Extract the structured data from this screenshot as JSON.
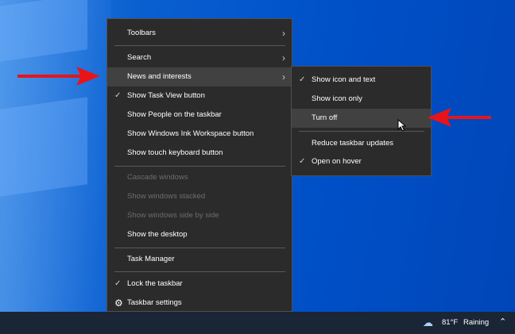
{
  "main_menu": {
    "items": [
      {
        "label": "Toolbars",
        "submenu": true
      },
      {
        "label": "Search",
        "submenu": true
      },
      {
        "label": "News and interests",
        "submenu": true,
        "highlighted": true
      },
      {
        "label": "Show Task View button",
        "checked": true
      },
      {
        "label": "Show People on the taskbar"
      },
      {
        "label": "Show Windows Ink Workspace button"
      },
      {
        "label": "Show touch keyboard button"
      },
      {
        "label": "Cascade windows",
        "disabled": true
      },
      {
        "label": "Show windows stacked",
        "disabled": true
      },
      {
        "label": "Show windows side by side",
        "disabled": true
      },
      {
        "label": "Show the desktop"
      },
      {
        "label": "Task Manager"
      },
      {
        "label": "Lock the taskbar",
        "checked": true
      },
      {
        "label": "Taskbar settings",
        "icon": "gear-icon"
      }
    ]
  },
  "submenu": {
    "items": [
      {
        "label": "Show icon and text",
        "checked": true
      },
      {
        "label": "Show icon only"
      },
      {
        "label": "Turn off",
        "highlighted": true
      },
      {
        "label": "Reduce taskbar updates"
      },
      {
        "label": "Open on hover",
        "checked": true
      }
    ]
  },
  "taskbar": {
    "weather_temp": "81°F",
    "weather_condition": "Raining"
  },
  "colors": {
    "arrow": "#e8141a",
    "menu_bg": "#2b2b2b",
    "taskbar": "#1a2536"
  }
}
